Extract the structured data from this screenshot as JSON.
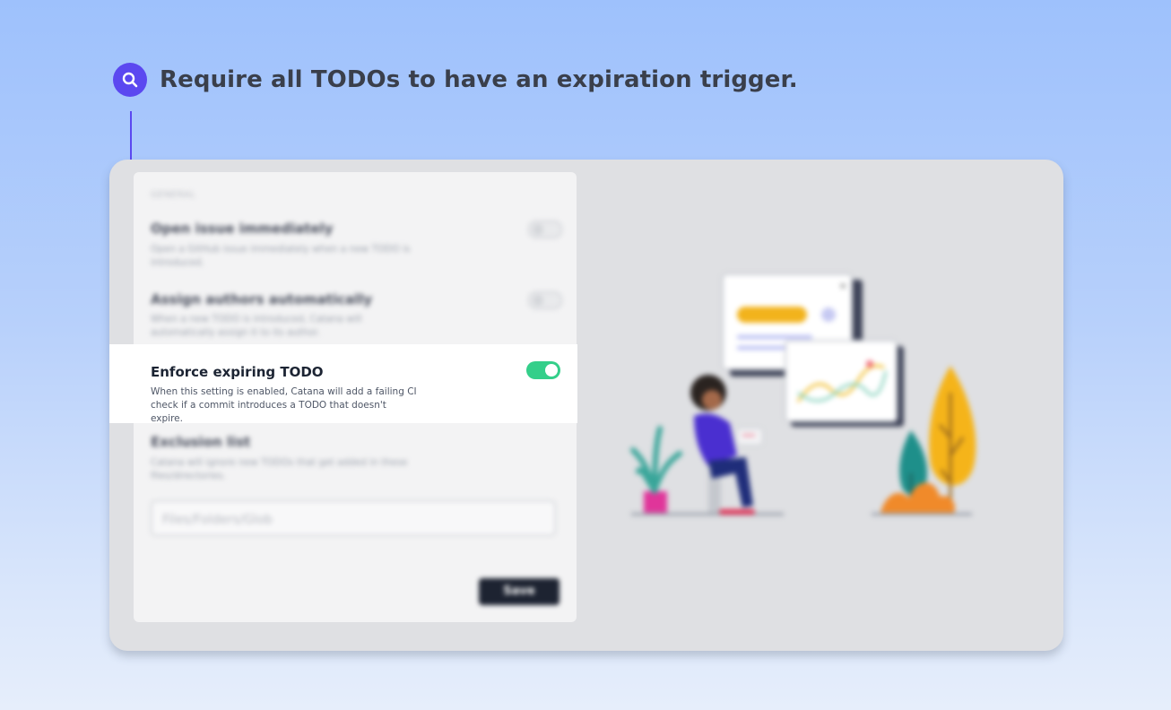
{
  "headline": {
    "text": "Require all TODOs to have an expiration trigger.",
    "icon": "search-icon"
  },
  "settings": {
    "section_label": "GENERAL",
    "items": [
      {
        "title": "Open issue immediately",
        "description": "Open a GitHub issue immediately when a new TODO is introduced.",
        "enabled": false
      },
      {
        "title": "Assign authors automatically",
        "description": "When a new TODO is introduced, Catana will automatically assign it to its author.",
        "enabled": false
      },
      {
        "title": "Enforce expiring TODO",
        "description": "When this setting is enabled, Catana will add a failing CI check if a commit introduces a TODO that doesn't expire.",
        "enabled": true
      },
      {
        "title": "Exclusion list",
        "description": "Catana will ignore new TODOs that get added in these files/directories."
      }
    ],
    "exclusion_placeholder": "Files/Folders/Glob",
    "save_label": "Save"
  },
  "colors": {
    "accent": "#5b48f0",
    "toggle_on": "#34cf8a",
    "save_button": "#1d2331"
  }
}
